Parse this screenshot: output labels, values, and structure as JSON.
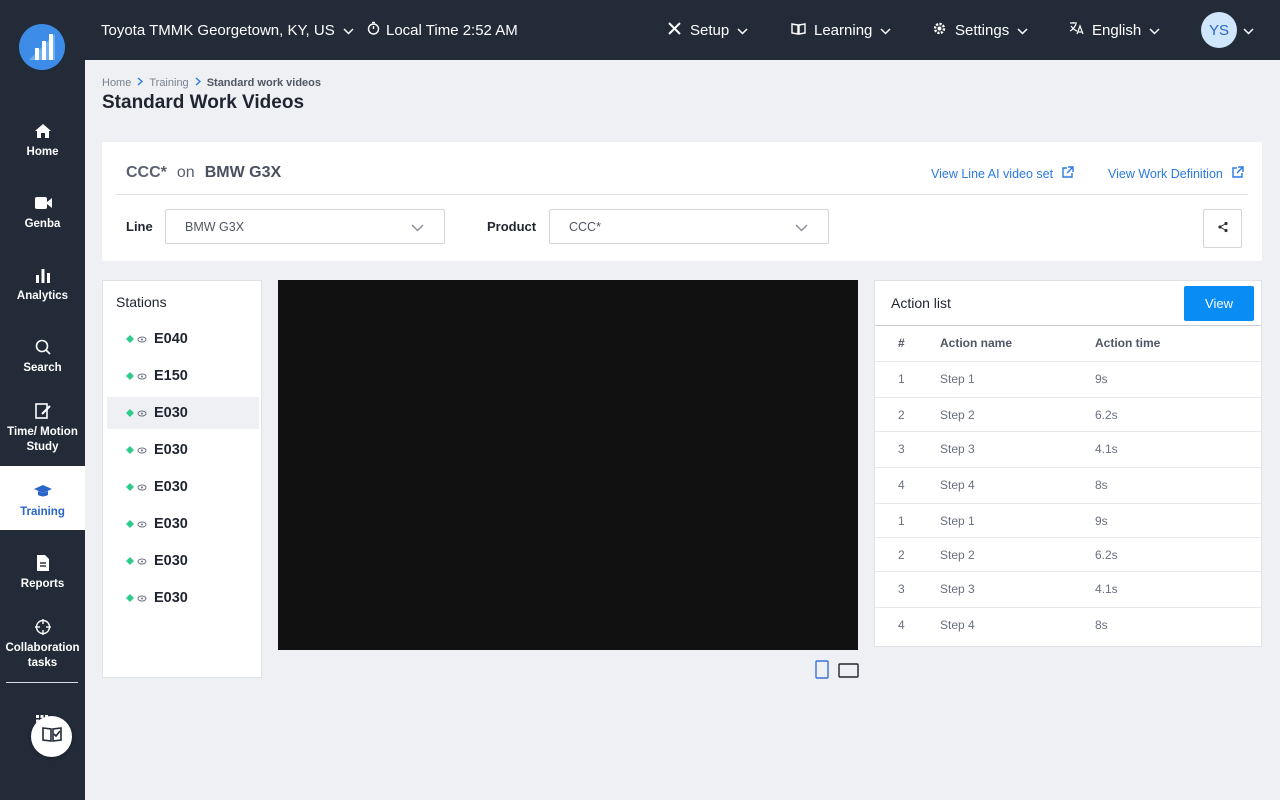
{
  "topbar": {
    "location": "Toyota TMMK Georgetown, KY, US",
    "local_time": "Local Time 2:52 AM",
    "setup": "Setup",
    "learning": "Learning",
    "settings": "Settings",
    "language": "English",
    "avatar_initials": "YS"
  },
  "sidebar": {
    "items": [
      {
        "label": "Home"
      },
      {
        "label": "Genba"
      },
      {
        "label": "Analytics"
      },
      {
        "label": "Search"
      },
      {
        "label": "Time/ Motion Study"
      },
      {
        "label": "Training"
      },
      {
        "label": "Reports"
      },
      {
        "label": "Collaboration tasks"
      }
    ],
    "active": "Training"
  },
  "breadcrumb": {
    "home": "Home",
    "training": "Training",
    "current": "Standard work videos"
  },
  "page_title": "Standard Work Videos",
  "filter": {
    "product_head": "CCC*",
    "on_text": "on",
    "line_head": "BMW G3X",
    "link_line_ai": "View Line AI video set",
    "link_work_def": "View Work Definition",
    "line_label": "Line",
    "line_value": "BMW G3X",
    "product_label": "Product",
    "product_value": "CCC*"
  },
  "stations": {
    "title": "Stations",
    "items": [
      "E040",
      "E150",
      "E030",
      "E030",
      "E030",
      "E030",
      "E030",
      "E030"
    ],
    "selected_index": 2
  },
  "action_list": {
    "title": "Action list",
    "view_button": "View",
    "headers": {
      "num": "#",
      "name": "Action name",
      "time": "Action time"
    },
    "rows": [
      {
        "num": "1",
        "name": "Step 1",
        "time": "9s"
      },
      {
        "num": "2",
        "name": "Step 2",
        "time": "6.2s"
      },
      {
        "num": "3",
        "name": "Step 3",
        "time": "4.1s"
      },
      {
        "num": "4",
        "name": "Step 4",
        "time": "8s"
      },
      {
        "num": "1",
        "name": "Step 1",
        "time": "9s"
      },
      {
        "num": "2",
        "name": "Step 2",
        "time": "6.2s"
      },
      {
        "num": "3",
        "name": "Step 3",
        "time": "4.1s"
      },
      {
        "num": "4",
        "name": "Step 4",
        "time": "8s"
      }
    ]
  },
  "colors": {
    "sidebar_bg": "#232a38",
    "accent": "#2a7ae2",
    "primary_button": "#0a8cf5",
    "station_diamond": "#2ecc8a",
    "video_bg": "#111111"
  }
}
